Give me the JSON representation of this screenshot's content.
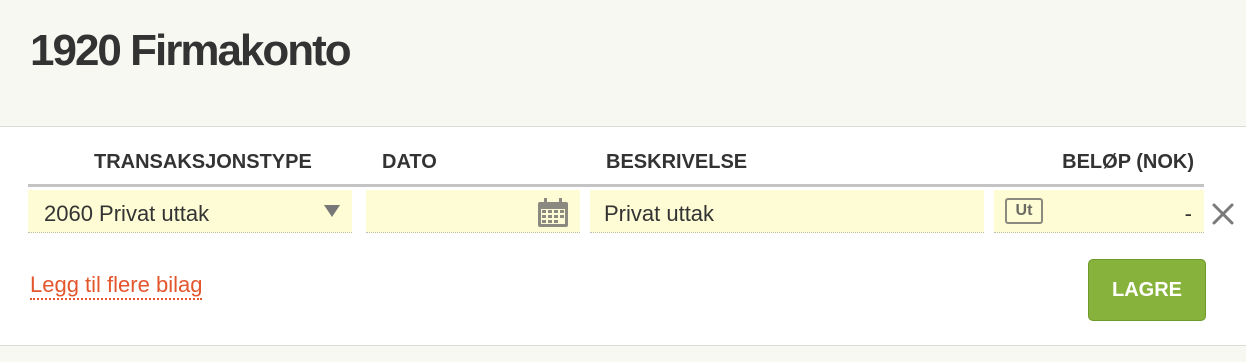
{
  "account": {
    "title": "1920 Firmakonto"
  },
  "columns": {
    "type": "TRANSAKSJONSTYPE",
    "date": "DATO",
    "description": "BESKRIVELSE",
    "amount": "BELØP (NOK)"
  },
  "row": {
    "type_value": "2060 Privat uttak",
    "date_value": "",
    "description_value": "Privat uttak",
    "direction_badge": "Ut",
    "amount_value": "-"
  },
  "actions": {
    "add_more_label": "Legg til flere bilag",
    "save_label": "LAGRE"
  },
  "icons": {
    "type_dropdown": "chevron-down-icon",
    "date_picker": "calendar-icon",
    "remove_row": "close-icon"
  },
  "colors": {
    "input_background": "#fdfcd4",
    "link": "#e4572e",
    "save_button": "#87b33c"
  }
}
